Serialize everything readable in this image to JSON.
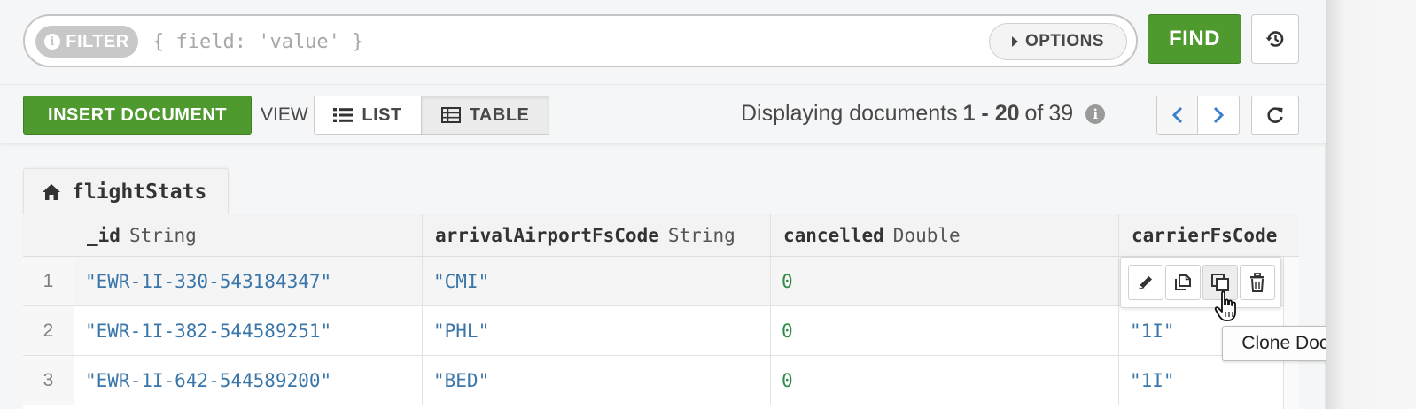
{
  "query_bar": {
    "filter_label": "FILTER",
    "filter_placeholder": "{ field: 'value' }",
    "options_label": "OPTIONS",
    "find_label": "FIND"
  },
  "toolbar": {
    "insert_label": "INSERT DOCUMENT",
    "view_label": "VIEW",
    "list_label": "LIST",
    "table_label": "TABLE",
    "active_view": "TABLE",
    "displaying_prefix": "Displaying documents",
    "range": "1 - 20",
    "of_text": "of",
    "total": "39"
  },
  "collection": {
    "name": "flightStats"
  },
  "grid": {
    "columns": [
      {
        "name": "_id",
        "type": "String"
      },
      {
        "name": "arrivalAirportFsCode",
        "type": "String"
      },
      {
        "name": "cancelled",
        "type": "Double"
      },
      {
        "name": "carrierFsCode",
        "type": ""
      }
    ],
    "rows": [
      {
        "num": "1",
        "id": "\"EWR-1I-330-543184347\"",
        "arrival": "\"CMI\"",
        "cancelled": "0",
        "carrier": ""
      },
      {
        "num": "2",
        "id": "\"EWR-1I-382-544589251\"",
        "arrival": "\"PHL\"",
        "cancelled": "0",
        "carrier": "\"1I\""
      },
      {
        "num": "3",
        "id": "\"EWR-1I-642-544589200\"",
        "arrival": "\"BED\"",
        "cancelled": "0",
        "carrier": "\"1I\""
      }
    ]
  },
  "row_actions": {
    "icons": [
      "pencil-icon",
      "copy-icon",
      "clone-icon",
      "trash-icon"
    ]
  },
  "tooltip": {
    "text": "Clone Document"
  },
  "colors": {
    "accent_green": "#4f9a2e",
    "string_blue": "#3a76a9",
    "number_green": "#2e8b48",
    "nav_blue": "#3a7fd0"
  }
}
